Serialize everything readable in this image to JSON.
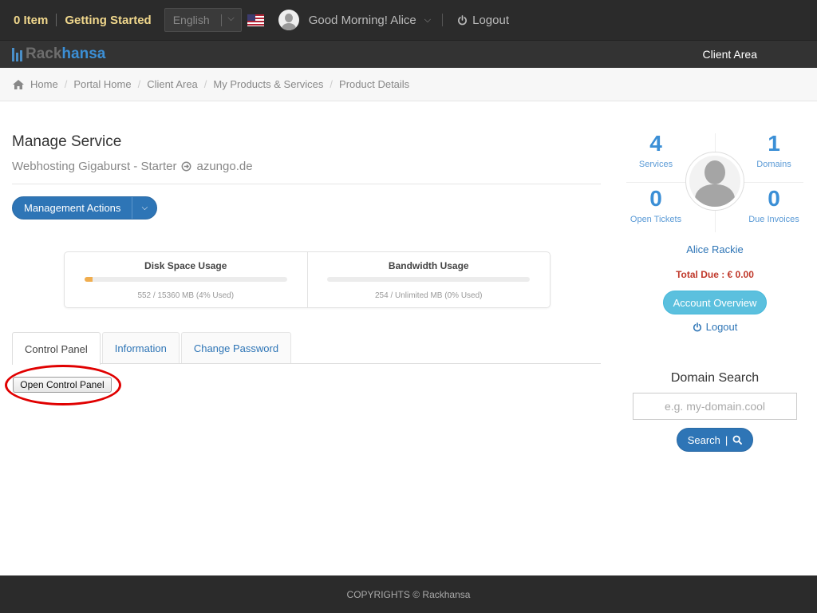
{
  "topbar": {
    "cart": "0 Item",
    "getting_started": "Getting Started",
    "language": "English",
    "greeting": "Good Morning! Alice",
    "logout": "Logout"
  },
  "brand": {
    "part1": "Rack",
    "part2": "hansa",
    "client_area": "Client Area"
  },
  "breadcrumb": [
    "Home",
    "Portal Home",
    "Client Area",
    "My Products & Services",
    "Product Details"
  ],
  "main": {
    "title": "Manage Service",
    "service_name": "Webhosting Gigaburst - Starter",
    "domain": "azungo.de",
    "management_actions": "Management Actions",
    "usage": [
      {
        "title": "Disk Space Usage",
        "detail": "552 / 15360 MB (4% Used)",
        "percent": 4
      },
      {
        "title": "Bandwidth Usage",
        "detail": "254 / Unlimited MB (0% Used)",
        "percent": 0
      }
    ],
    "tabs": [
      "Control Panel",
      "Information",
      "Change Password"
    ],
    "open_control_panel": "Open Control Panel"
  },
  "sidebar": {
    "stats": {
      "services": {
        "value": "4",
        "label": "Services"
      },
      "domains": {
        "value": "1",
        "label": "Domains"
      },
      "tickets": {
        "value": "0",
        "label": "Open Tickets"
      },
      "invoices": {
        "value": "0",
        "label": "Due Invoices"
      }
    },
    "user_name": "Alice Rackie",
    "total_due": "Total Due : € 0.00",
    "account_overview": "Account Overview",
    "logout": "Logout",
    "domain_search_title": "Domain Search",
    "domain_search_placeholder": "e.g. my-domain.cool",
    "search_label": "Search"
  },
  "footer": {
    "copyright": "COPYRIGHTS © Rackhansa"
  },
  "colors": {
    "accent": "#2e75b6",
    "info": "#5bc0de",
    "topbar": "#2b2b2b",
    "highlight": "#f0d78c",
    "danger": "#c0392b"
  }
}
